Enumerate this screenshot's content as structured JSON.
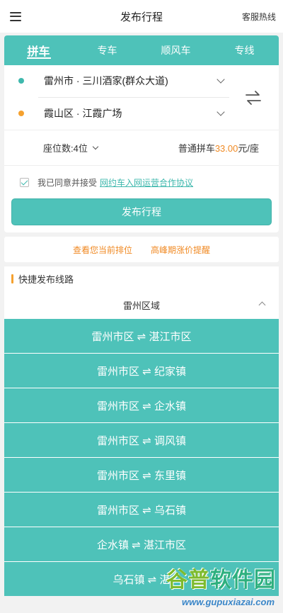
{
  "header": {
    "title": "发布行程",
    "hotline": "客服热线",
    "menu_icon": "hamburger-menu-icon"
  },
  "tabs": [
    {
      "label": "拼车",
      "active": true
    },
    {
      "label": "专车",
      "active": false
    },
    {
      "label": "顺风车",
      "active": false
    },
    {
      "label": "专线",
      "active": false
    }
  ],
  "route": {
    "from": "雷州市 · 三川酒家(群众大道)",
    "to": "霞山区 · 江霞广场",
    "swap_icon": "swap-arrows-icon"
  },
  "seats": {
    "label": "座位数:4位",
    "price_prefix": "普通拼车",
    "price_amount": "33.00",
    "price_suffix": "元/座"
  },
  "agreement": {
    "text": "我已同意并接受",
    "link": "网约车入网运营合作协议",
    "checked": true
  },
  "publish_button": "发布行程",
  "rank_links": [
    "查看您当前排位",
    "高峰期涨价提醒"
  ],
  "quick": {
    "title": "快捷发布线路",
    "region": "雷州区域",
    "routes": [
      "雷州市区 ⇌ 湛江市区",
      "雷州市区 ⇌ 纪家镇",
      "雷州市区 ⇌ 企水镇",
      "雷州市区 ⇌ 调风镇",
      "雷州市区 ⇌ 东里镇",
      "雷州市区 ⇌ 乌石镇",
      "企水镇 ⇌ 湛江市区",
      "乌石镇 ⇌ 湛"
    ]
  },
  "watermark": {
    "title_a": "谷普",
    "title_b": "软件园",
    "url": "www.gupuxiazai.com"
  },
  "colors": {
    "accent": "#4ec2b9",
    "orange": "#f08a24",
    "from_dot": "#3fb8ad",
    "to_dot": "#f5a12f"
  }
}
